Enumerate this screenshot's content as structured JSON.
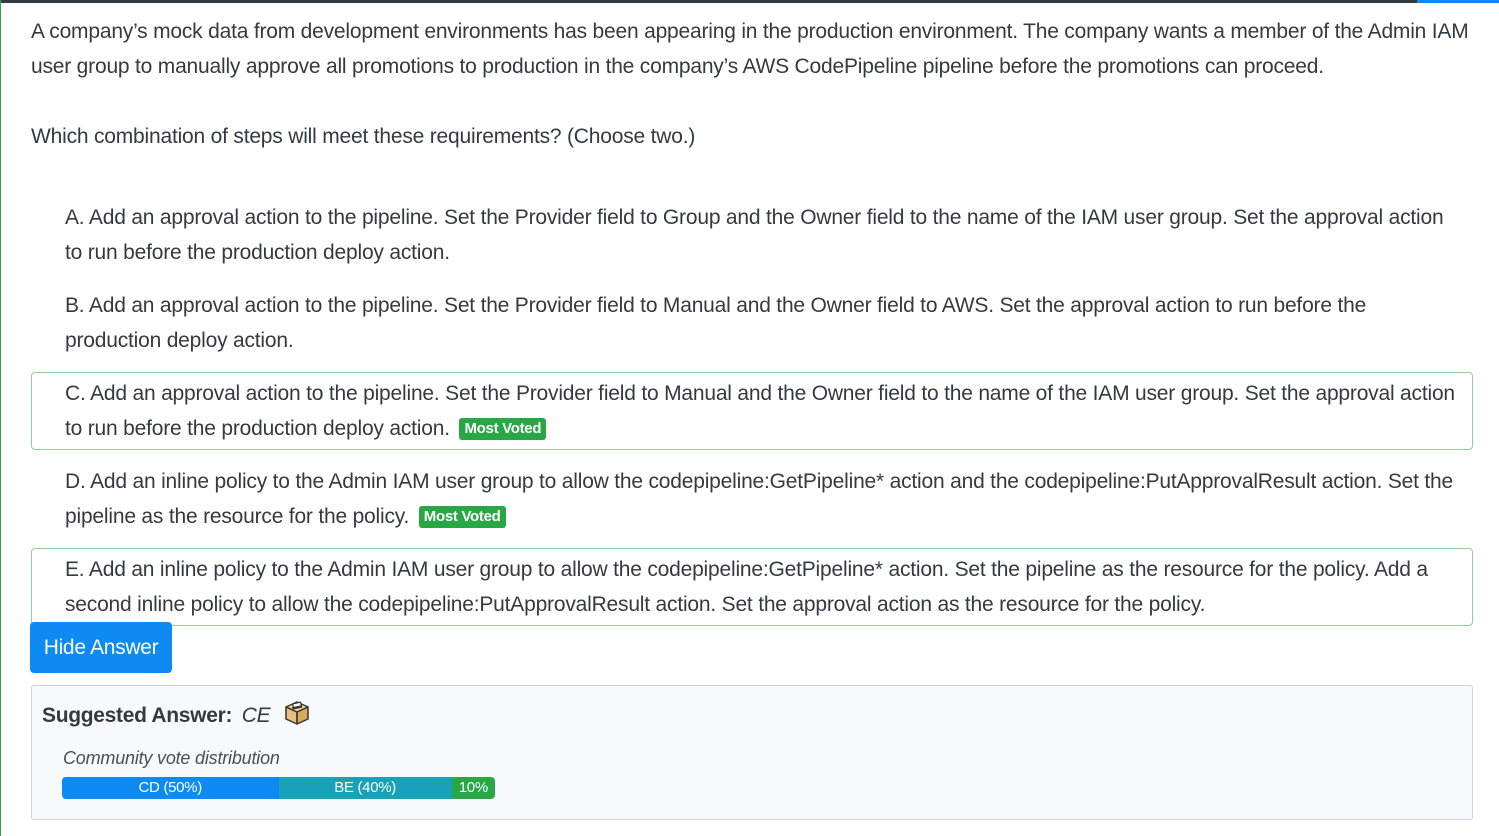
{
  "question": {
    "intro": "A company’s mock data from development environments has been appearing in the production environment. The company wants a member of the Admin IAM user group to manually approve all promotions to production in the company’s AWS CodePipeline pipeline before the promotions can proceed.",
    "prompt": "Which combination of steps will meet these requirements? (Choose two.)"
  },
  "choices": [
    {
      "text": "A. Add an approval action to the pipeline. Set the Provider field to Group and the Owner field to the name of the IAM user group. Set the approval action to run before the production deploy action.",
      "badge": ""
    },
    {
      "text": "B. Add an approval action to the pipeline. Set the Provider field to Manual and the Owner field to AWS. Set the approval action to run before the production deploy action.",
      "badge": ""
    },
    {
      "text": "C. Add an approval action to the pipeline. Set the Provider field to Manual and the Owner field to the name of the IAM user group. Set the approval action to run before the production deploy action.",
      "badge": "Most Voted"
    },
    {
      "text": "D. Add an inline policy to the Admin IAM user group to allow the codepipeline:GetPipeline* action and the codepipeline:PutApprovalResult action. Set the pipeline as the resource for the policy.",
      "badge": "Most Voted"
    },
    {
      "text": "E. Add an inline policy to the Admin IAM user group to allow the codepipeline:GetPipeline* action. Set the pipeline as the resource for the policy. Add a second inline policy to allow the codepipeline:PutApprovalResult action. Set the approval action as the resource for the policy.",
      "badge": ""
    }
  ],
  "hide_answer_label": "Hide Answer",
  "answer": {
    "label": "Suggested Answer:",
    "value": "CE",
    "icon": "ballot-box-icon",
    "vote_title": "Community vote distribution",
    "votes": [
      {
        "label": "CD (50%)",
        "percent": 50,
        "color": "#0d8bf2"
      },
      {
        "label": "BE (40%)",
        "percent": 40,
        "color": "#17a2b8"
      },
      {
        "label": "10%",
        "percent": 10,
        "color": "#28a745"
      }
    ]
  },
  "colors": {
    "primary": "#0d8bf2",
    "success": "#28a745",
    "info": "#17a2b8",
    "correct_border": "#8fd19e"
  }
}
